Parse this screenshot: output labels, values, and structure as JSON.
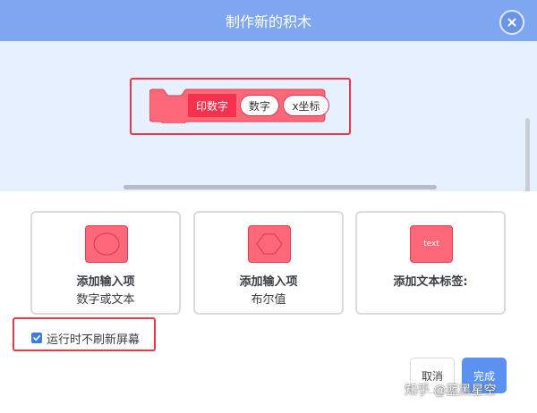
{
  "dialog": {
    "title": "制作新的积木",
    "close_icon": "close-icon"
  },
  "preview": {
    "block_label": "印数字",
    "inputs": [
      "数字",
      "x坐标"
    ],
    "block_color": "#fc6877"
  },
  "options": [
    {
      "icon": "oval-input-icon",
      "line1": "添加输入项",
      "line2": "数字或文本"
    },
    {
      "icon": "hexagon-input-icon",
      "line1": "添加输入项",
      "line2": "布尔值"
    },
    {
      "icon": "text-label-icon",
      "icon_text": "text",
      "line1": "添加文本标签:",
      "line2": ""
    }
  ],
  "refresh": {
    "label": "运行时不刷新屏幕",
    "checked": true
  },
  "buttons": {
    "cancel": "取消",
    "done": "完成"
  },
  "watermark": "知乎 @蓝黑星空",
  "colors": {
    "header": "#7fa6f0",
    "preview_bg": "#e6f0ff",
    "accent": "#5b92f2",
    "highlight": "#e13a4b"
  }
}
